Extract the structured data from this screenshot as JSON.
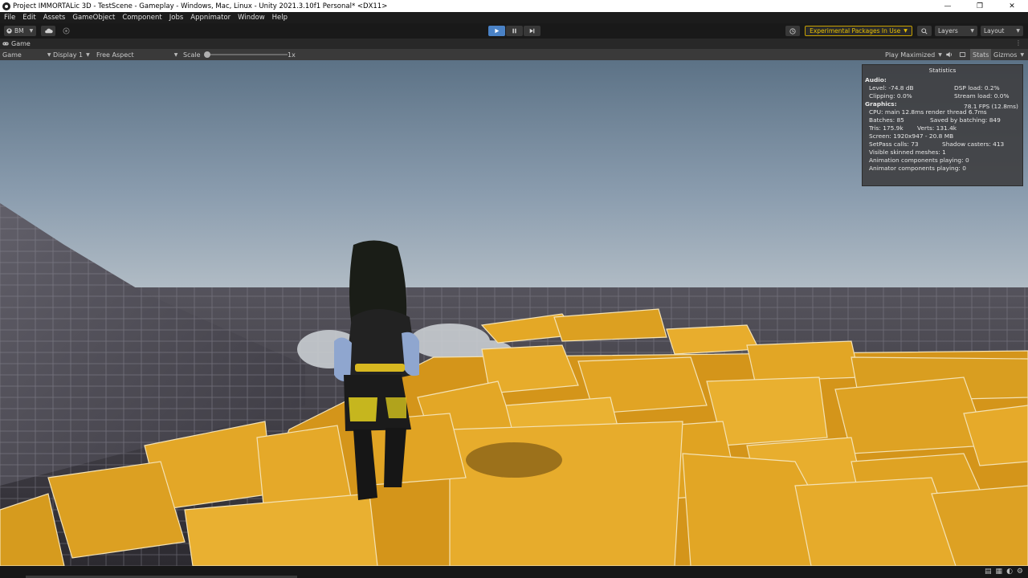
{
  "window": {
    "title": "Project IMMORTALic 3D - TestScene - Gameplay - Windows, Mac, Linux - Unity 2021.3.10f1 Personal* <DX11>",
    "controls": [
      "—",
      "❐",
      "✕"
    ]
  },
  "menu": [
    "File",
    "Edit",
    "Assets",
    "GameObject",
    "Component",
    "Jobs",
    "Appnimator",
    "Window",
    "Help"
  ],
  "toolbar": {
    "account": "BM",
    "experimental": "Experimental Packages In Use",
    "layers": "Layers",
    "layout": "Layout"
  },
  "tab": {
    "label": "Game"
  },
  "gamebar": {
    "mode": "Game",
    "display": "Display 1",
    "aspect": "Free Aspect",
    "scale_label": "Scale",
    "scale_value": "1x",
    "play_mode": "Play Maximized",
    "stats": "Stats",
    "gizmos": "Gizmos"
  },
  "stats": {
    "title": "Statistics",
    "audio_header": "Audio:",
    "level": "Level: -74.8 dB",
    "dsp": "DSP load: 0.2%",
    "clipping": "Clipping: 0.0%",
    "stream": "Stream load: 0.0%",
    "graphics_header": "Graphics:",
    "fps": "78.1 FPS (12.8ms)",
    "cpu": "CPU: main 12.8ms  render thread 6.7ms",
    "batches": "Batches: 85",
    "saved": "Saved by batching: 849",
    "tris": "Tris: 175.9k",
    "verts": "Verts: 131.4k",
    "screen": "Screen: 1920x947 - 20.8 MB",
    "setpass": "SetPass calls: 73",
    "shadow": "Shadow casters: 413",
    "skinned": "Visible skinned meshes: 1",
    "anim": "Animation components playing: 0",
    "animator": "Animator components playing: 0"
  },
  "colors": {
    "accent_play": "#4a82c6",
    "experimental": "#e8c000",
    "sky_top": "#5f7488",
    "boxes": "#e0a21f"
  }
}
